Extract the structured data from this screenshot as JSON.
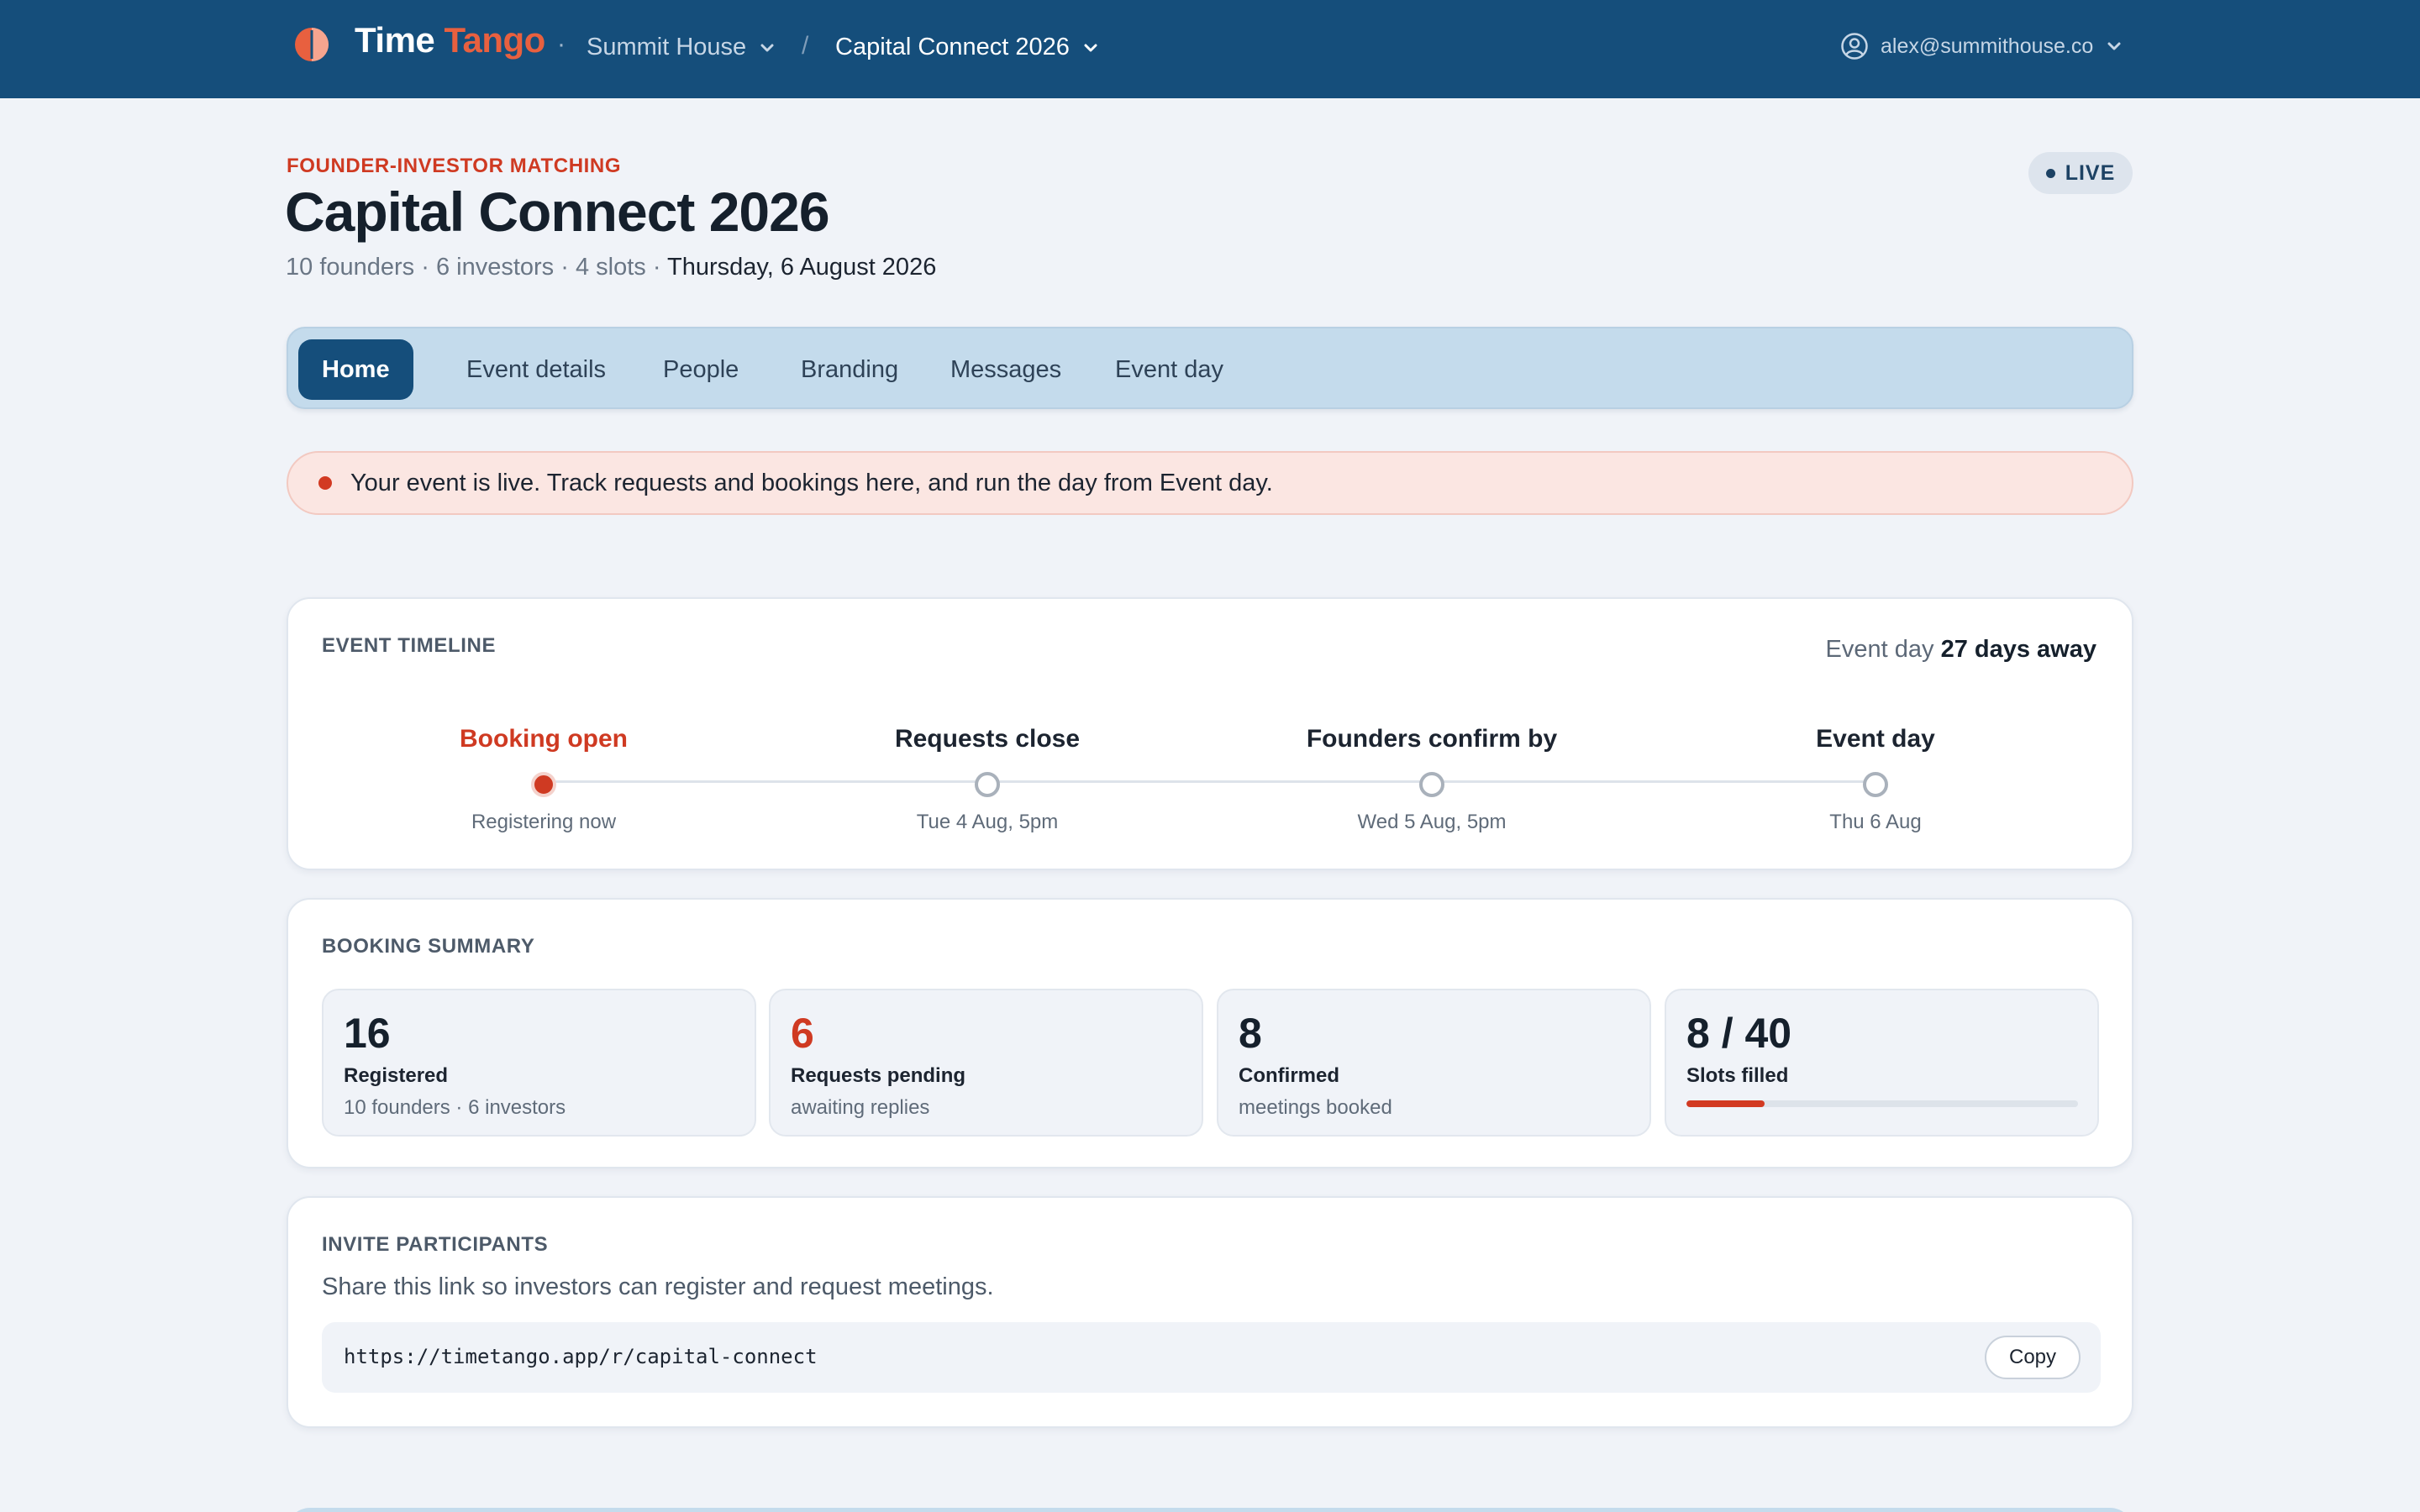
{
  "brand": {
    "name_part1": "Time",
    "name_part2": "Tango",
    "accent": "#e8603f"
  },
  "breadcrumb": {
    "separator_dot": "·",
    "organization": "Summit House",
    "separator": "/",
    "event": "Capital Connect 2026"
  },
  "account": {
    "email": "alex@summithouse.co"
  },
  "header": {
    "eyebrow": "FOUNDER-INVESTOR MATCHING",
    "title": "Capital Connect 2026",
    "meta": "10 founders · 6 investors · 4 slots  ·",
    "date": "Thursday, 6 August 2026",
    "status": "LIVE"
  },
  "tabs": [
    {
      "label": "Home",
      "active": true
    },
    {
      "label": "Event details"
    },
    {
      "label": "People"
    },
    {
      "label": "Branding"
    },
    {
      "label": "Messages"
    },
    {
      "label": "Event day"
    }
  ],
  "alert": {
    "text": "Your event is live. Track requests and bookings here, and run the day from Event day."
  },
  "timeline": {
    "title": "EVENT TIMELINE",
    "countdown_prefix": "Event day",
    "countdown_value": "27 days away",
    "steps": [
      {
        "label": "Booking open",
        "sub": "Registering now"
      },
      {
        "label": "Requests close",
        "sub": "Tue 4 Aug, 5pm"
      },
      {
        "label": "Founders confirm by",
        "sub": "Wed 5 Aug, 5pm"
      },
      {
        "label": "Event day",
        "sub": "Thu 6 Aug"
      }
    ]
  },
  "summary": {
    "title": "BOOKING SUMMARY",
    "stats": [
      {
        "value": "16",
        "label": "Registered",
        "sub": "10 founders · 6 investors"
      },
      {
        "value": "6",
        "label": "Requests pending",
        "sub": "awaiting replies"
      },
      {
        "value": "8",
        "label": "Confirmed",
        "sub": "meetings booked"
      },
      {
        "value": "8 / 40",
        "label": "Slots filled",
        "progress": 0.2
      }
    ]
  },
  "invite": {
    "title": "INVITE PARTICIPANTS",
    "description": "Share this link so investors can register and request meetings.",
    "link": "https://timetango.app/r/capital-connect",
    "copy_label": "Copy"
  }
}
